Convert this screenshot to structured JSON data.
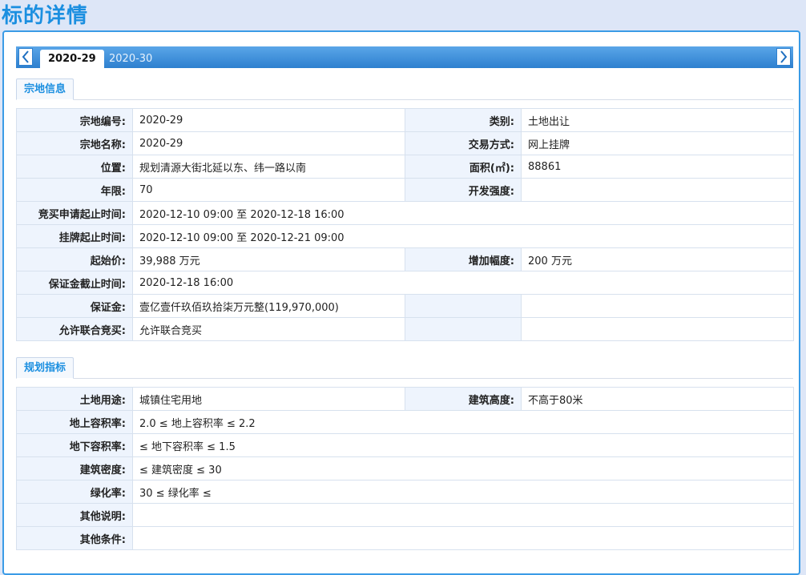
{
  "page_title": "标的详情",
  "tabs": [
    {
      "label": "2020-29",
      "active": true
    },
    {
      "label": "2020-30",
      "active": false
    }
  ],
  "section1": {
    "title": "宗地信息",
    "rows": [
      {
        "l1": "宗地编号:",
        "v1": "2020-29",
        "l2": "类别:",
        "v2": "土地出让"
      },
      {
        "l1": "宗地名称:",
        "v1": "2020-29",
        "l2": "交易方式:",
        "v2": "网上挂牌"
      },
      {
        "l1": "位置:",
        "v1": "规划清源大街北延以东、纬一路以南",
        "l2": "面积(㎡):",
        "v2": "88861"
      },
      {
        "l1": "年限:",
        "v1": "70",
        "l2": "开发强度:",
        "v2": ""
      },
      {
        "l1": "竞买申请起止时间:",
        "v1": "2020-12-10 09:00 至 2020-12-18 16:00"
      },
      {
        "l1": "挂牌起止时间:",
        "v1": "2020-12-10 09:00 至 2020-12-21 09:00"
      },
      {
        "l1": "起始价:",
        "v1": "39,988 万元",
        "l2": "增加幅度:",
        "v2": "200 万元"
      },
      {
        "l1": "保证金截止时间:",
        "v1": "2020-12-18 16:00"
      },
      {
        "l1": "保证金:",
        "v1": "壹亿壹仟玖佰玖拾柒万元整(119,970,000)",
        "l2": "",
        "v2": ""
      },
      {
        "l1": "允许联合竞买:",
        "v1": "允许联合竞买",
        "l2": "",
        "v2": ""
      }
    ]
  },
  "section2": {
    "title": "规划指标",
    "rows": [
      {
        "l1": "土地用途:",
        "v1": "城镇住宅用地",
        "l2": "建筑高度:",
        "v2": "不高于80米"
      },
      {
        "l1": "地上容积率:",
        "v1": "2.0 ≤ 地上容积率 ≤ 2.2"
      },
      {
        "l1": "地下容积率:",
        "v1": "≤ 地下容积率 ≤ 1.5"
      },
      {
        "l1": "建筑密度:",
        "v1": "≤ 建筑密度 ≤ 30"
      },
      {
        "l1": "绿化率:",
        "v1": "30 ≤ 绿化率 ≤"
      },
      {
        "l1": "其他说明:",
        "v1": ""
      },
      {
        "l1": "其他条件:",
        "v1": ""
      }
    ]
  },
  "icons": {
    "prev": "chevron-left-icon",
    "next": "chevron-right-icon"
  },
  "colors": {
    "accent": "#1b8fe0",
    "tab_bar": "#2e80cf",
    "label_bg": "#eef4fd"
  }
}
